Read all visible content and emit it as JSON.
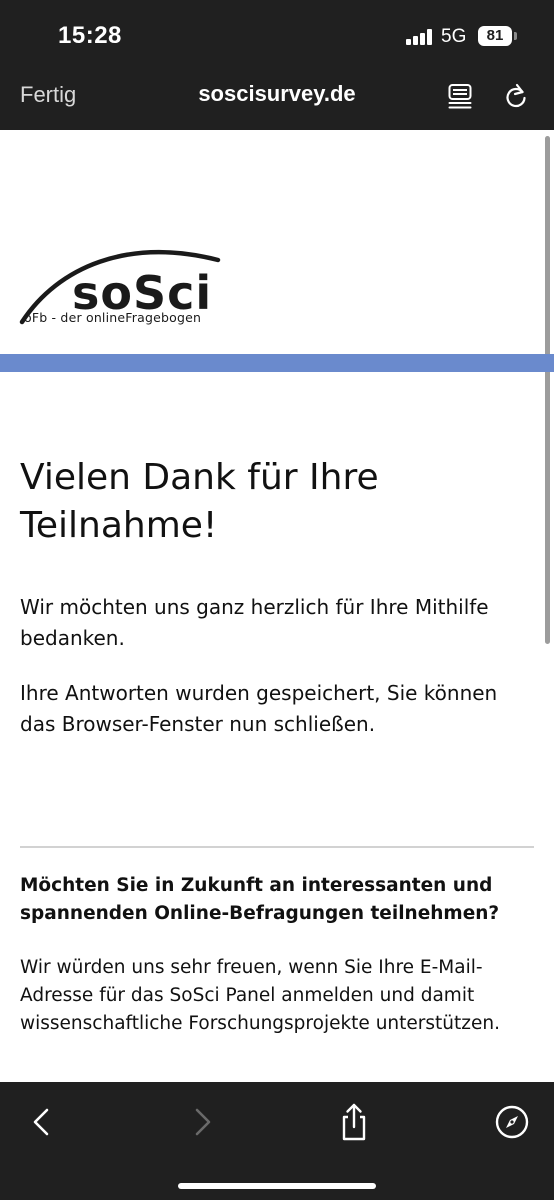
{
  "status_bar": {
    "time": "15:28",
    "network": "5G",
    "battery_level": "81",
    "signal_icon": "cellular-signal-icon"
  },
  "browser": {
    "done_label": "Fertig",
    "url": "soscisurvey.de",
    "reader_icon": "reader-mode-icon",
    "reload_icon": "reload-icon",
    "back_icon": "chevron-left-icon",
    "forward_icon": "chevron-right-icon",
    "share_icon": "share-icon",
    "compass_icon": "compass-icon",
    "forward_enabled": false
  },
  "page": {
    "logo_text": "soSci",
    "logo_subtitle": "oFb - der onlineFragebogen",
    "accent_color": "#6a8acd",
    "heading": "Vielen Dank für Ihre Teilnahme!",
    "paragraph1": "Wir möchten uns ganz herzlich für Ihre Mithilfe bedanken.",
    "paragraph2": "Ihre Antworten wurden gespeichert, Sie können das Browser-Fenster nun schließen.",
    "panel_title": "Möchten Sie in Zukunft an interessanten und spannenden Online-Befragungen teilnehmen?",
    "panel_text": "Wir würden uns sehr freuen, wenn Sie Ihre E-Mail-Adresse für das SoSci Panel anmelden und damit wissenschaftliche Forschungsprojekte unterstützen."
  }
}
